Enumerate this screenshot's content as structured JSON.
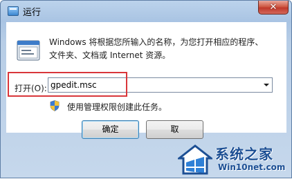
{
  "window": {
    "title": "运行",
    "close_symbol": "✕",
    "message_line1": "Windows 将根据您所输入的名称，为您打开相应的程序、",
    "message_line2": "文件夹、文档或 Internet 资源。"
  },
  "open_field": {
    "label": "打开(O):",
    "value": "gpedit.msc"
  },
  "admin_notice": "使用管理权限创建此任务。",
  "buttons": {
    "ok_label": "确定",
    "cancel_label": "取"
  },
  "watermark": {
    "title": "系统之家",
    "url": "Win10net.com"
  },
  "icons": {
    "app": "run-dialog-icon",
    "run": "run-program-icon",
    "shield": "uac-shield-icon",
    "dropdown": "chevron-down-icon",
    "watermark": "house-logo-icon"
  },
  "colors": {
    "highlight_box": "#d9363a",
    "close_button": "#c0392b",
    "watermark_text": "#1c4f94"
  }
}
